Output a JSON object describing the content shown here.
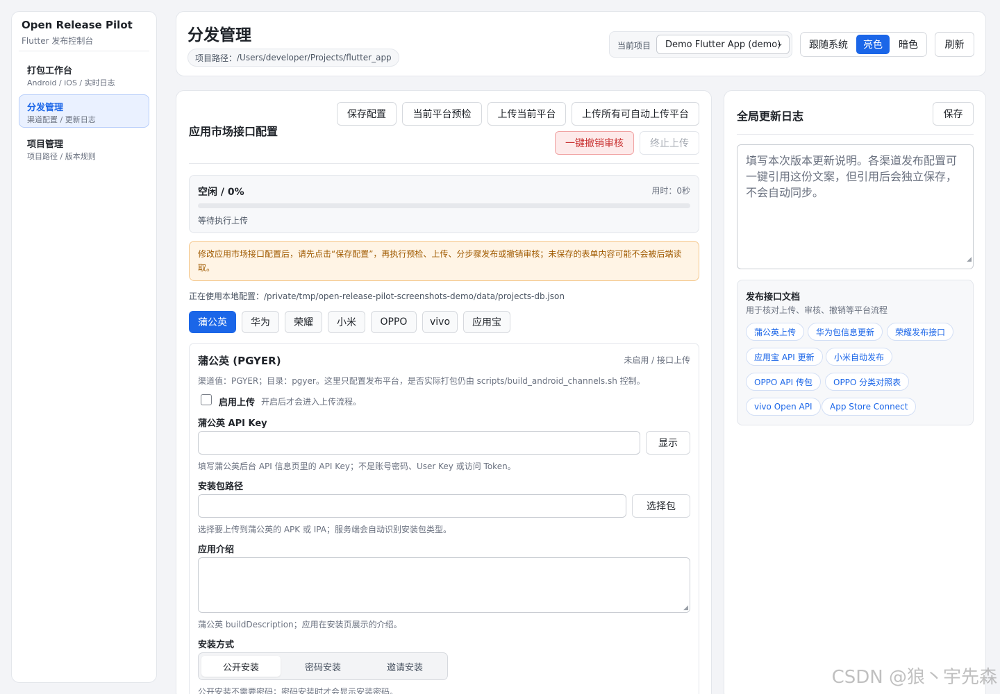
{
  "sidebar": {
    "brand_title": "Open Release Pilot",
    "brand_subtitle": "Flutter 发布控制台",
    "items": [
      {
        "label": "打包工作台",
        "sub": "Android / iOS / 实时日志",
        "active": false
      },
      {
        "label": "分发管理",
        "sub": "渠道配置 / 更新日志",
        "active": true
      },
      {
        "label": "项目管理",
        "sub": "项目路径 / 版本规则",
        "active": false
      }
    ]
  },
  "header": {
    "title": "分发管理",
    "path_label": "项目路径：",
    "path_value": "/Users/developer/Projects/flutter_app",
    "project_label": "当前项目",
    "project_value": "Demo Flutter App (demo)",
    "theme_options": [
      "跟随系统",
      "亮色",
      "暗色"
    ],
    "theme_selected": "亮色",
    "refresh_label": "刷新"
  },
  "main": {
    "title": "应用市场接口配置",
    "toolbar": {
      "save": "保存配置",
      "precheck": "当前平台预检",
      "upload_current": "上传当前平台",
      "upload_all": "上传所有可自动上传平台",
      "revoke": "一键撤销审核",
      "stop": "终止上传"
    },
    "progress": {
      "status": "空闲 / 0%",
      "elapsed": "用时：0秒",
      "percent": 0,
      "message": "等待执行上传"
    },
    "warning": "修改应用市场接口配置后，请先点击“保存配置”，再执行预检、上传、分步骤发布或撤销审核；未保存的表单内容可能不会被后端读取。",
    "config_path_label": "正在使用本地配置：",
    "config_path": "/private/tmp/open-release-pilot-screenshots-demo/data/projects-db.json",
    "tabs": [
      "蒲公英",
      "华为",
      "荣耀",
      "小米",
      "OPPO",
      "vivo",
      "应用宝"
    ],
    "active_tab": "蒲公英",
    "channel": {
      "name": "蒲公英 (PGYER)",
      "status": "未启用 / 接口上传",
      "desc": "渠道值：PGYER；目录：pgyer。这里只配置发布平台，是否实际打包仍由 scripts/build_android_channels.sh 控制。",
      "enable_label": "启用上传",
      "enable_hint": "开启后才会进入上传流程。",
      "enabled": false,
      "api_key_label": "蒲公英 API Key",
      "api_key_value": "",
      "show_btn": "显示",
      "api_key_help": "填写蒲公英后台 API 信息页里的 API Key；不是账号密码、User Key 或访问 Token。",
      "pkg_label": "安装包路径",
      "pkg_value": "",
      "pick_btn": "选择包",
      "pkg_help": "选择要上传到蒲公英的 APK 或 IPA；服务端会自动识别安装包类型。",
      "intro_label": "应用介绍",
      "intro_value": "",
      "intro_help": "蒲公英 buildDescription；应用在安装页展示的介绍。",
      "install_label": "安装方式",
      "install_options": [
        "公开安装",
        "密码安装",
        "邀请安装"
      ],
      "install_selected": "公开安装",
      "install_help": "公开安装不需要密码；密码安装时才会显示安装密码。"
    }
  },
  "right": {
    "title": "全局更新日志",
    "save": "保存",
    "placeholder": "填写本次版本更新说明。各渠道发布配置可一键引用这份文案，但引用后会独立保存，不会自动同步。",
    "docs_title": "发布接口文档",
    "docs_sub": "用于核对上传、审核、撤销等平台流程",
    "docs": [
      "蒲公英上传",
      "华为包信息更新",
      "荣耀发布接口",
      "应用宝 API 更新",
      "小米自动发布",
      "OPPO API 传包",
      "OPPO 分类对照表",
      "vivo Open API",
      "App Store Connect"
    ]
  },
  "watermark": "CSDN @狼丶宇先森",
  "colors": {
    "accent": "#1b66e8",
    "danger": "#c93333",
    "warning_text": "#a05a00",
    "warning_bg": "#fff4e5"
  }
}
